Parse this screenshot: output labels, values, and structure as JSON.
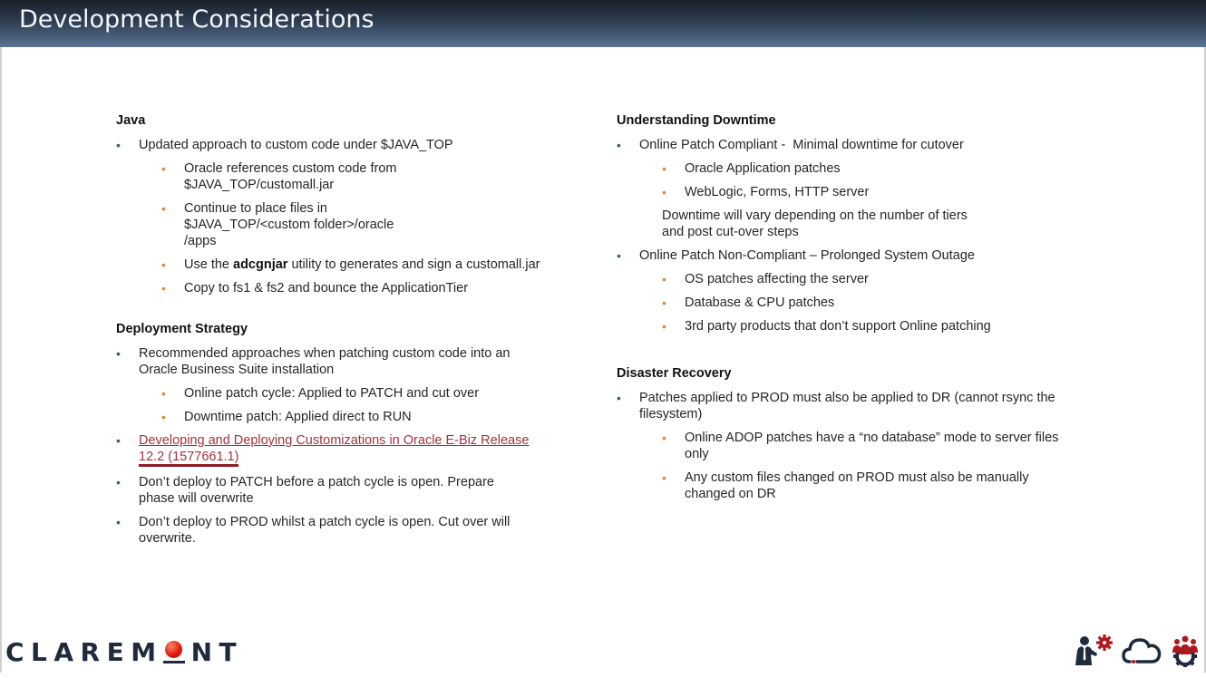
{
  "header": {
    "title": "Development Considerations"
  },
  "left": {
    "java": {
      "title": "Java",
      "items": [
        {
          "text": "Updated approach to custom code under $JAVA_TOP",
          "sub": [
            "Oracle references custom code from $JAVA_TOP/customall.jar",
            "Continue to place files in $JAVA_TOP/<custom folder>/oracle /apps",
            {
              "pre": "Use the ",
              "bold": "adcgnjar",
              "post": " utility to generates and sign a customall.jar"
            },
            "Copy to fs1 & fs2 and bounce the ApplicationTier"
          ]
        }
      ]
    },
    "deployment": {
      "title": "Deployment Strategy",
      "items": [
        {
          "text": "Recommended approaches when patching custom code into an Oracle Business Suite installation",
          "sub": [
            "Online patch cycle: Applied to PATCH and cut over",
            "Downtime patch: Applied direct to RUN"
          ]
        },
        {
          "link_line1": "Developing and Deploying Customizations in Oracle E-Biz Release",
          "link_line2": "12.2 (1577661.1)"
        },
        {
          "text": "Don’t deploy to PATCH before a patch cycle is open. Prepare phase will overwrite"
        },
        {
          "text": "Don’t deploy to PROD whilst a patch cycle is open. Cut over will overwrite."
        }
      ]
    }
  },
  "right": {
    "downtime": {
      "title": "Understanding Downtime",
      "items": [
        {
          "text": "Online Patch Compliant -  Minimal downtime for cutover",
          "sub": [
            "Oracle Application patches",
            "WebLogic, Forms, HTTP server"
          ],
          "note": "Downtime will vary depending on the number of tiers and post cut-over steps"
        },
        {
          "text": "Online Patch Non-Compliant – Prolonged System Outage",
          "sub": [
            "OS patches affecting the server",
            "Database & CPU patches",
            "3rd party products that don’t support Online patching"
          ]
        }
      ]
    },
    "dr": {
      "title": "Disaster Recovery",
      "items": [
        {
          "text": "Patches applied to PROD must also be applied to DR (cannot rsync the filesystem)",
          "sub": [
            "Online ADOP patches have a “no database” mode to server files only",
            "Any custom files changed on PROD must also be manually changed on DR"
          ]
        }
      ]
    }
  },
  "footer": {
    "logo_pre": "CLAREM",
    "logo_post": "NT",
    "icons": [
      "consultant-gear-icon",
      "cloud-icon",
      "team-gear-icon"
    ],
    "colors": {
      "navy": "#1f2a3d",
      "red": "#b0171d",
      "bullet_primary": "#2e6b5a",
      "bullet_secondary": "#e0883a",
      "link": "#a3333a"
    }
  }
}
